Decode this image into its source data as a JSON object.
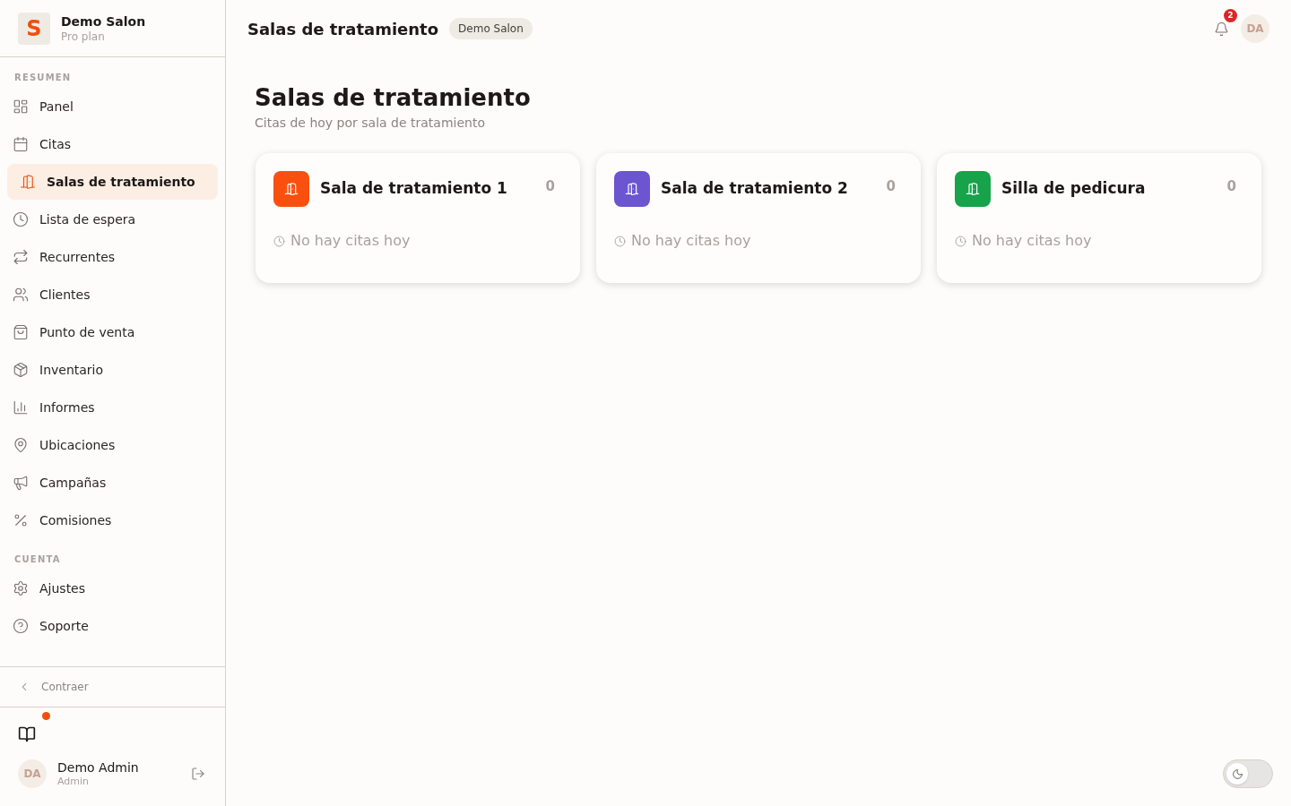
{
  "sidebar": {
    "brand": {
      "logo": "S",
      "name": "Demo Salon",
      "plan": "Pro plan"
    },
    "sections": [
      {
        "title": "RESUMEN",
        "items": [
          {
            "label": "Panel",
            "selected": false
          },
          {
            "label": "Citas",
            "selected": false
          },
          {
            "label": "Salas de tratamiento",
            "selected": true
          },
          {
            "label": "Lista de espera",
            "selected": false
          },
          {
            "label": "Recurrentes",
            "selected": false
          },
          {
            "label": "Clientes",
            "selected": false
          },
          {
            "label": "Punto de venta",
            "selected": false
          },
          {
            "label": "Inventario",
            "selected": false
          },
          {
            "label": "Informes",
            "selected": false
          },
          {
            "label": "Ubicaciones",
            "selected": false
          },
          {
            "label": "Campañas",
            "selected": false
          },
          {
            "label": "Comisiones",
            "selected": false
          }
        ]
      },
      {
        "title": "CUENTA",
        "items": [
          {
            "label": "Ajustes",
            "selected": false
          },
          {
            "label": "Soporte",
            "selected": false
          }
        ]
      }
    ],
    "collapse": {
      "label": "Contraer"
    },
    "guide": {
      "unread": true
    },
    "user": {
      "initials": "DA",
      "name": "Demo Admin",
      "role": "Admin"
    }
  },
  "header": {
    "title": "Salas de tratamiento",
    "badge": "Demo Salon",
    "notifications": "2",
    "avatar": "DA"
  },
  "page": {
    "title": "Salas de tratamiento",
    "subtitle": "Citas de hoy por sala de tratamiento"
  },
  "rooms": [
    {
      "name": "Sala de tratamiento 1",
      "count": "0",
      "color": "#fa500f",
      "status": "No hay citas hoy"
    },
    {
      "name": "Sala de tratamiento 2",
      "count": "0",
      "color": "#6c55d0",
      "status": "No hay citas hoy"
    },
    {
      "name": "Silla de pedicura",
      "count": "0",
      "color": "#16a34a",
      "status": "No hay citas hoy"
    }
  ],
  "theme_toggle": {
    "on": false
  }
}
